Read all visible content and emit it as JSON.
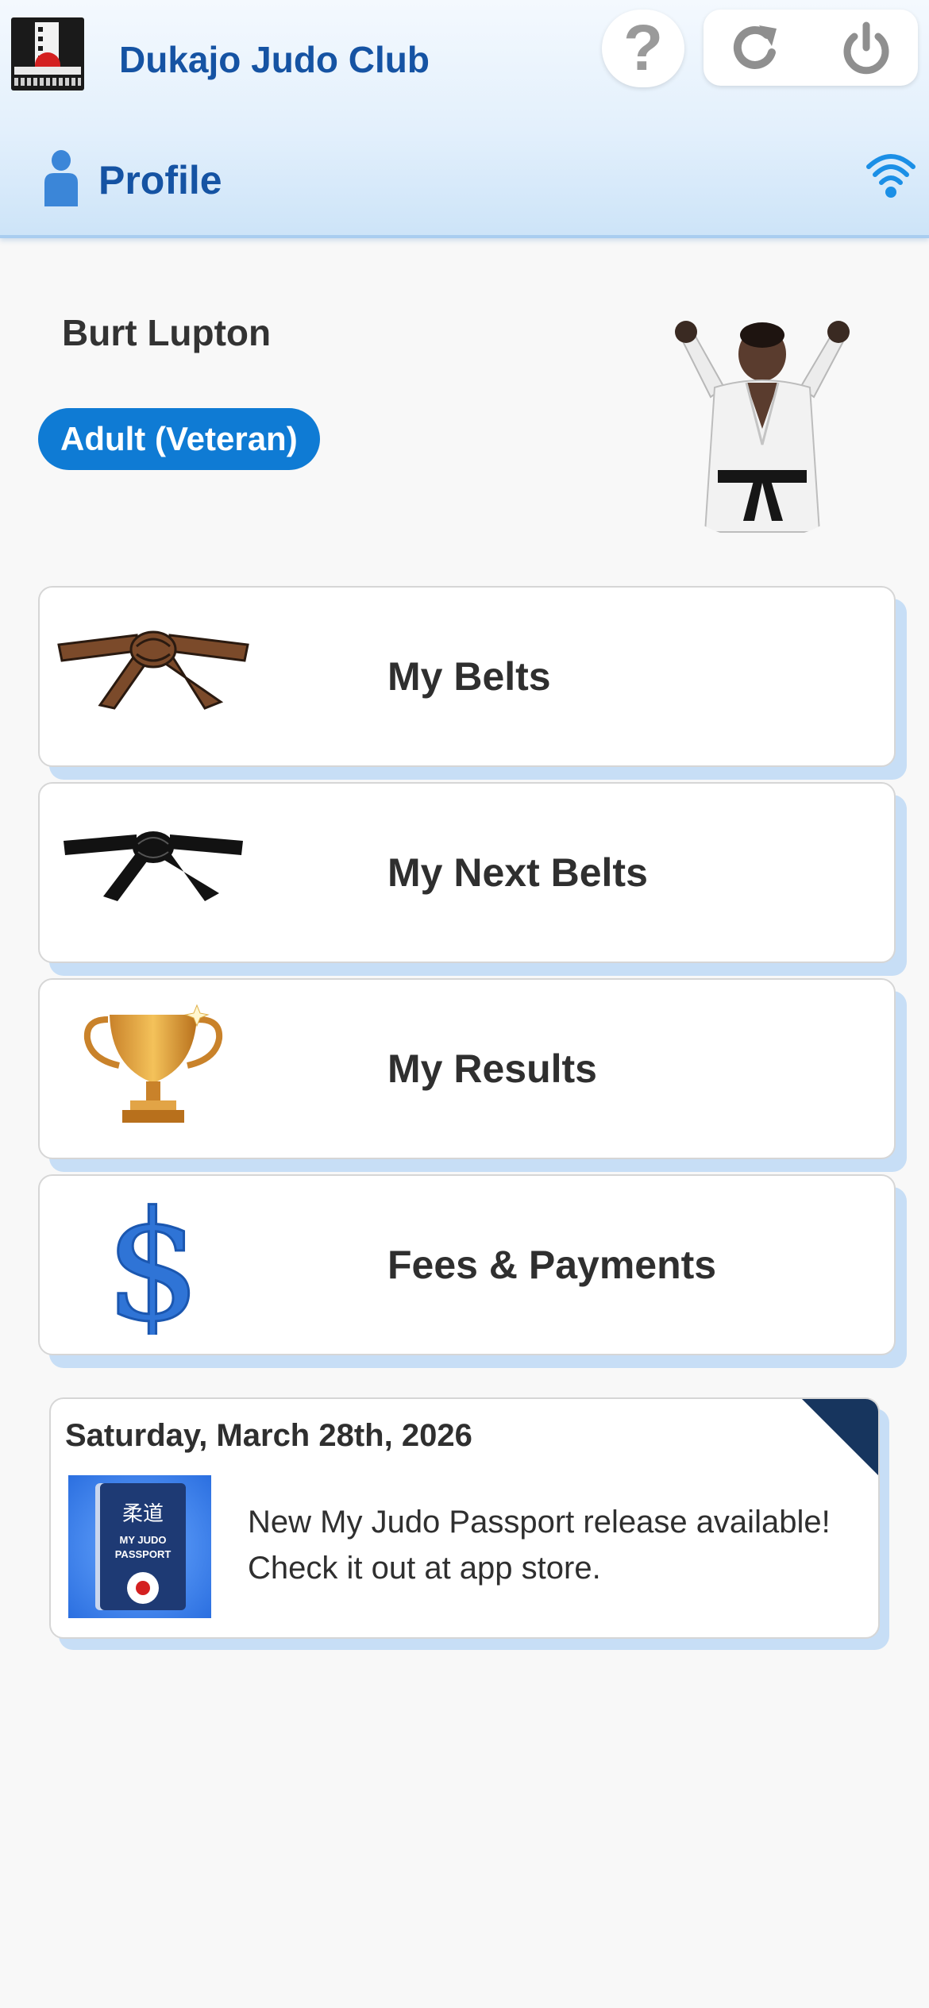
{
  "header": {
    "club_name": "Dukajo Judo Club",
    "help_glyph": "?",
    "section_title": "Profile",
    "accent_color": "#1553a3"
  },
  "profile": {
    "member_name": "Burt Lupton",
    "category_badge": "Adult (Veteran)",
    "badge_color": "#0f7bd4"
  },
  "menu": [
    {
      "label": "My Belts",
      "icon": "brown-belt-icon"
    },
    {
      "label": "My Next Belts",
      "icon": "black-belt-icon"
    },
    {
      "label": "My Results",
      "icon": "trophy-icon"
    },
    {
      "label": "Fees & Payments",
      "icon": "dollar-icon"
    }
  ],
  "news": {
    "date": "Saturday, March 28th, 2026",
    "message": "New My Judo Passport release available! Check it out at app store.",
    "thumbnail_kanji": "柔道",
    "thumbnail_line1": "MY JUDO",
    "thumbnail_line2": "PASSPORT"
  }
}
